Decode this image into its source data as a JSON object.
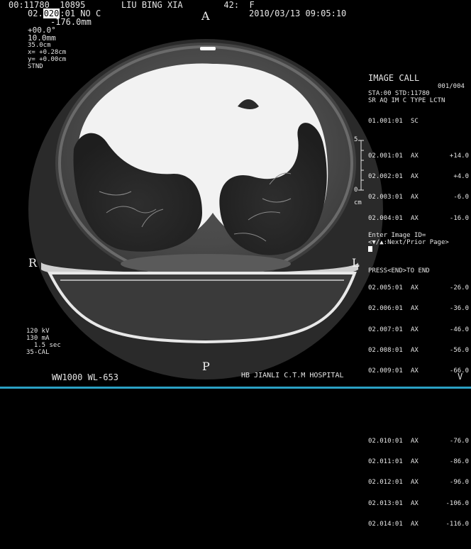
{
  "header": {
    "line1": "00:11780  10895       LIU BING XIA        42:  F",
    "line2_prefix": "02.",
    "line2_cursor": "020",
    "line2_suffix": ":01 NO C",
    "date_time": "2010/03/13 09:05:10",
    "line3": "-176.0mm",
    "tilt": "+00.0°",
    "thickness": "10.0mm",
    "fov": "35.0cm",
    "x_offset": "x= +0.28cm",
    "y_offset": "y= +0.00cm",
    "mode": "STND"
  },
  "orientation": {
    "top": "A",
    "bottom": "P",
    "left": "R",
    "right": "L"
  },
  "image_call": {
    "title": "IMAGE CALL",
    "page": "001/004",
    "study": "STA:00 STD:11780",
    "header_row": "SR AQ IM C TYPE LCTN",
    "first": {
      "id": "01.001:01",
      "type": "SC",
      "loc": ""
    },
    "groups": [
      [
        {
          "id": "02.001:01",
          "type": "AX",
          "loc": "+14.0"
        },
        {
          "id": "02.002:01",
          "type": "AX",
          "loc": "+4.0"
        },
        {
          "id": "02.003:01",
          "type": "AX",
          "loc": "-6.0"
        },
        {
          "id": "02.004:01",
          "type": "AX",
          "loc": "-16.0"
        }
      ],
      [
        {
          "id": "02.005:01",
          "type": "AX",
          "loc": "-26.0"
        },
        {
          "id": "02.006:01",
          "type": "AX",
          "loc": "-36.0"
        },
        {
          "id": "02.007:01",
          "type": "AX",
          "loc": "-46.0"
        },
        {
          "id": "02.008:01",
          "type": "AX",
          "loc": "-56.0"
        },
        {
          "id": "02.009:01",
          "type": "AX",
          "loc": "-66.0"
        }
      ],
      [
        {
          "id": "02.010:01",
          "type": "AX",
          "loc": "-76.0"
        },
        {
          "id": "02.011:01",
          "type": "AX",
          "loc": "-86.0"
        },
        {
          "id": "02.012:01",
          "type": "AX",
          "loc": "-96.0"
        },
        {
          "id": "02.013:01",
          "type": "AX",
          "loc": "-106.0"
        },
        {
          "id": "02.014:01",
          "type": "AX",
          "loc": "-116.0"
        }
      ]
    ],
    "prompt": "Enter Image ID=",
    "nav_hint": "<▼/▲:Next/Prior Page>",
    "end_hint": "PRESS<END>TO END"
  },
  "scale": {
    "top_label": "5",
    "bottom_label": "0",
    "unit": "cm"
  },
  "acquisition": {
    "kv": "120 kV",
    "ma": "130 mA",
    "time": "  1.5 sec",
    "cal": "35-CAL"
  },
  "footer": {
    "window": "WW1000 WL-653",
    "hospital": "HB JIANLI C.T.M HOSPITAL",
    "marker": "V"
  }
}
